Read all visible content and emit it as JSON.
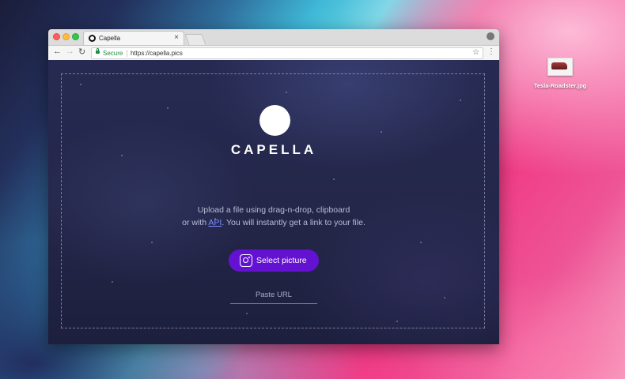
{
  "browser": {
    "tab_title": "Capella",
    "tab_close": "×",
    "secure_label": "Secure",
    "url": "https://capella.pics",
    "nav": {
      "back": "←",
      "forward": "→",
      "reload": "↻"
    },
    "star": "☆",
    "menu": "⋮"
  },
  "page": {
    "brand": "CAPELLA",
    "description_line1": "Upload a file using drag-n-drop, clipboard",
    "description_line2_prefix": "or with ",
    "api_link": "API",
    "description_line2_suffix": ". You will instantly get a link to your file.",
    "select_button": "Select picture",
    "paste_url_placeholder": "Paste URL"
  },
  "desktop": {
    "file_name": "Tesla-Roadster.jpg"
  },
  "colors": {
    "button": "#6412d1",
    "page_bg": "#242749",
    "link": "#7f8cff",
    "secure": "#1e8e3e"
  }
}
